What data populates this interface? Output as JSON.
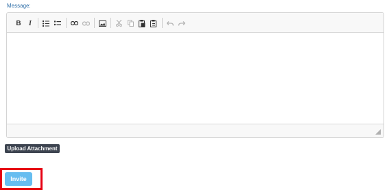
{
  "form": {
    "message_label": "Message:",
    "upload_label": "Upload Attachment",
    "invite_label": "Invite"
  },
  "toolbar": {
    "items": [
      {
        "icon": "bold-icon",
        "glyph": "B",
        "enabled": true
      },
      {
        "icon": "italic-icon",
        "glyph": "I",
        "enabled": true
      },
      {
        "icon": "numbered-list-icon",
        "enabled": true
      },
      {
        "icon": "bulleted-list-icon",
        "enabled": true
      },
      {
        "icon": "link-icon",
        "enabled": true
      },
      {
        "icon": "unlink-icon",
        "enabled": false
      },
      {
        "icon": "image-icon",
        "enabled": true
      },
      {
        "icon": "cut-icon",
        "enabled": false
      },
      {
        "icon": "copy-icon",
        "enabled": false
      },
      {
        "icon": "paste-icon",
        "enabled": true
      },
      {
        "icon": "paste-text-icon",
        "enabled": true
      },
      {
        "icon": "undo-icon",
        "enabled": false
      },
      {
        "icon": "redo-icon",
        "enabled": false
      }
    ]
  },
  "colors": {
    "label": "#2f6fa8",
    "upload_button": "#3d4450",
    "invite_button": "#66bdf0",
    "highlight_border": "#e60012",
    "icon_enabled": "#333333",
    "icon_disabled": "#b5b5b5"
  }
}
